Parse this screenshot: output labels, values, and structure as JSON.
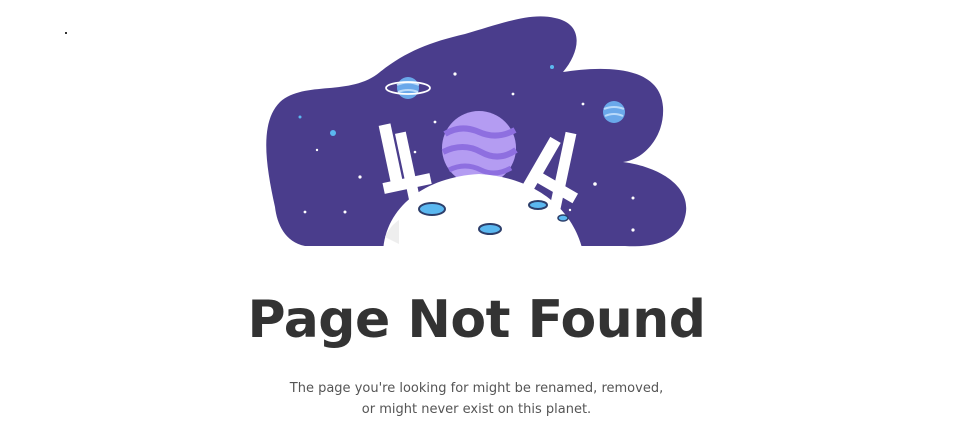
{
  "content": {
    "title": "Page Not Found",
    "message_line1": "The page you're looking for might be renamed, removed,",
    "message_line2": "or might never exist on this planet."
  },
  "illustration": {
    "digits": [
      "4",
      "4"
    ],
    "icons": [
      "space-blob",
      "ringed-planet-icon",
      "small-planet-icon",
      "purple-planet-icon",
      "moon-icon",
      "stars"
    ]
  },
  "colors": {
    "space": "#4a3d8c",
    "planet": "#b49cf2",
    "planet_stripe": "#8e6fe0",
    "crater": "#5bb8f0",
    "title": "#333333",
    "text": "#555555"
  }
}
